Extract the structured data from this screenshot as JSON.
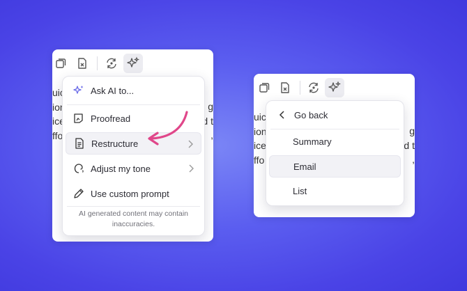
{
  "left_panel": {
    "doc_lines_left": [
      "uick",
      "ion",
      "ice",
      "ffo"
    ],
    "doc_lines_right": [
      "g",
      "d t",
      ","
    ],
    "menu": {
      "ask_ai": "Ask AI to...",
      "items": [
        {
          "label": "Proofread"
        },
        {
          "label": "Restructure"
        },
        {
          "label": "Adjust my tone"
        },
        {
          "label": "Use custom prompt"
        }
      ],
      "disclaimer_line1": "AI generated content may contain",
      "disclaimer_line2": "inaccuracies."
    }
  },
  "right_panel": {
    "doc_lines_left": [
      "uick",
      "ion",
      "ice",
      "ffo"
    ],
    "doc_lines_right": [
      "g",
      "d t",
      ","
    ],
    "menu": {
      "go_back": "Go back",
      "items": [
        {
          "label": "Summary"
        },
        {
          "label": "Email"
        },
        {
          "label": "List"
        }
      ]
    }
  },
  "colors": {
    "accent_arrow": "#e0478a",
    "sparkle": "#6b6ce8"
  }
}
